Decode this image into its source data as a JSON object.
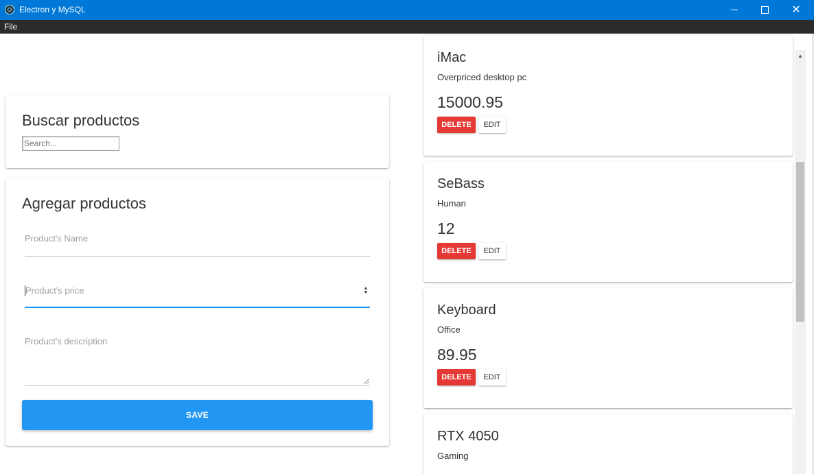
{
  "window": {
    "title": "Electron y MySQL",
    "minimize_glyph": "minimize",
    "maximize_glyph": "maximize",
    "close_glyph": "✕"
  },
  "menu": {
    "items": [
      "File"
    ]
  },
  "search": {
    "title": "Buscar productos",
    "placeholder": "Search..."
  },
  "add_form": {
    "title": "Agregar productos",
    "name_placeholder": "Product's Name",
    "price_placeholder": "Product's price",
    "description_placeholder": "Product's description",
    "save_label": "SAVE"
  },
  "products": [
    {
      "name": "iMac",
      "description": "Overpriced desktop pc",
      "price": "15000.95"
    },
    {
      "name": "SeBass",
      "description": "Human",
      "price": "12"
    },
    {
      "name": "Keyboard",
      "description": "Office",
      "price": "89.95"
    },
    {
      "name": "RTX 4050",
      "description": "Gaming",
      "price": ""
    }
  ],
  "product_actions": {
    "delete_label": "DELETE",
    "edit_label": "EDIT"
  },
  "colors": {
    "titlebar": "#0078d7",
    "menubar": "#2b2b2b",
    "accent": "#2196f3",
    "danger": "#e53935"
  }
}
